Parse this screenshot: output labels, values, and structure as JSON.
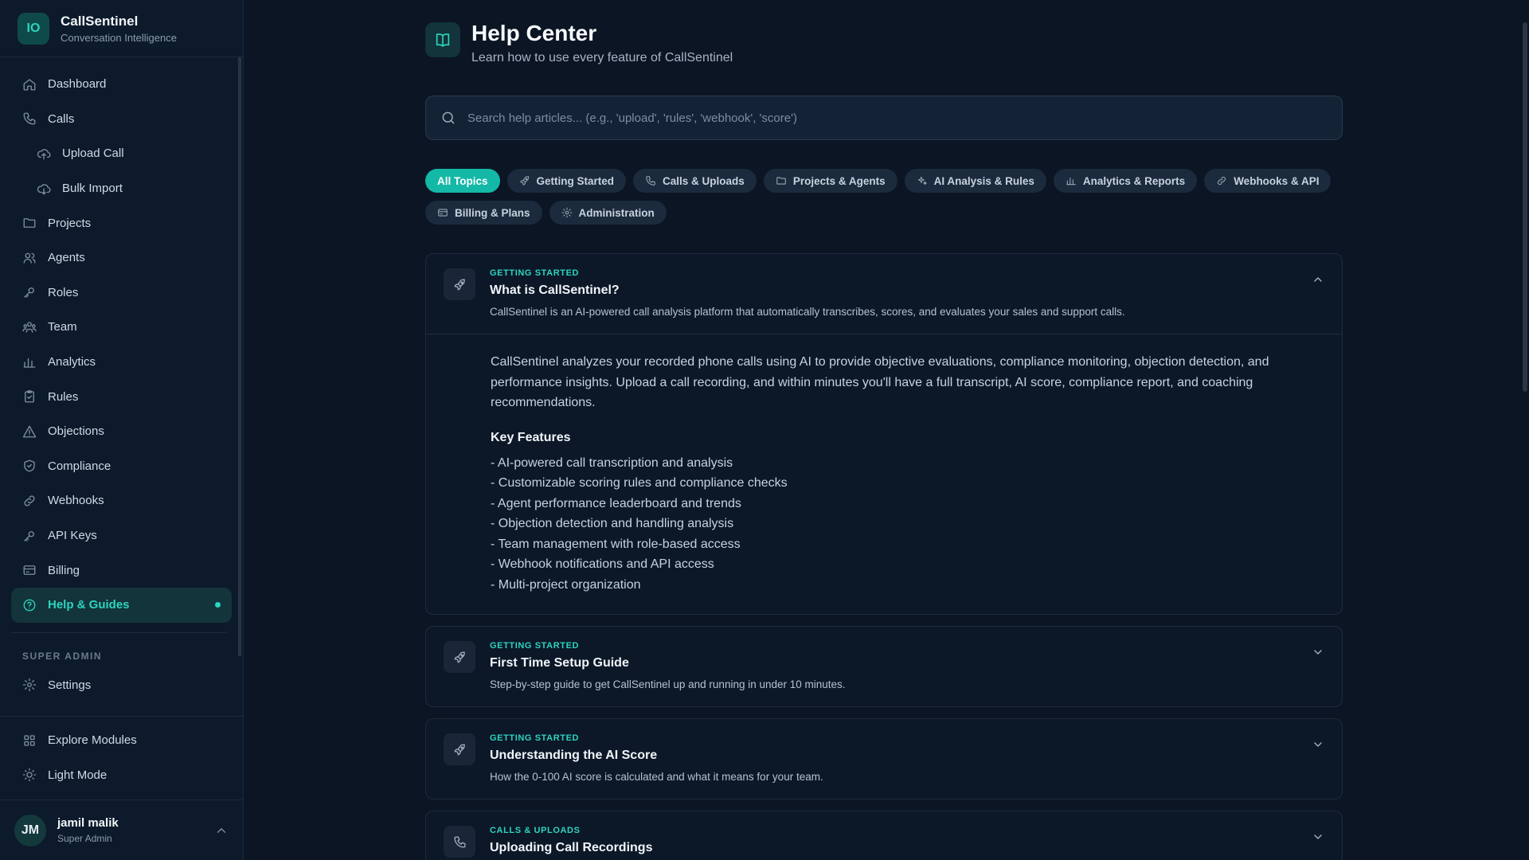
{
  "brand": {
    "logo": "IO",
    "name": "CallSentinel",
    "subtitle": "Conversation Intelligence"
  },
  "sidebar": {
    "items": [
      {
        "label": "Dashboard",
        "icon": "home-icon"
      },
      {
        "label": "Calls",
        "icon": "phone-icon"
      },
      {
        "label": "Upload Call",
        "icon": "cloud-upload-icon"
      },
      {
        "label": "Bulk Import",
        "icon": "cloud-download-icon"
      },
      {
        "label": "Projects",
        "icon": "folder-icon"
      },
      {
        "label": "Agents",
        "icon": "users-icon"
      },
      {
        "label": "Roles",
        "icon": "key-icon"
      },
      {
        "label": "Team",
        "icon": "team-icon"
      },
      {
        "label": "Analytics",
        "icon": "bar-chart-icon"
      },
      {
        "label": "Rules",
        "icon": "clipboard-icon"
      },
      {
        "label": "Objections",
        "icon": "warning-icon"
      },
      {
        "label": "Compliance",
        "icon": "shield-icon"
      },
      {
        "label": "Webhooks",
        "icon": "link-icon"
      },
      {
        "label": "API Keys",
        "icon": "key-icon"
      },
      {
        "label": "Billing",
        "icon": "credit-card-icon"
      },
      {
        "label": "Help & Guides",
        "icon": "help-circle-icon",
        "active": true
      }
    ],
    "section_label": "SUPER ADMIN",
    "settings_label": "Settings",
    "explore_label": "Explore Modules",
    "theme_label": "Light Mode"
  },
  "user": {
    "initials": "JM",
    "name": "jamil malik",
    "role": "Super Admin"
  },
  "header": {
    "title": "Help Center",
    "subtitle": "Learn how to use every feature of CallSentinel"
  },
  "search": {
    "placeholder": "Search help articles... (e.g., 'upload', 'rules', 'webhook', 'score')"
  },
  "chips": [
    {
      "label": "All Topics",
      "active": true
    },
    {
      "label": "Getting Started",
      "icon": "rocket-icon"
    },
    {
      "label": "Calls & Uploads",
      "icon": "phone-icon"
    },
    {
      "label": "Projects & Agents",
      "icon": "folder-icon"
    },
    {
      "label": "AI Analysis & Rules",
      "icon": "sparkles-icon"
    },
    {
      "label": "Analytics & Reports",
      "icon": "bar-chart-icon"
    },
    {
      "label": "Webhooks & API",
      "icon": "link-icon"
    },
    {
      "label": "Billing & Plans",
      "icon": "credit-card-icon"
    },
    {
      "label": "Administration",
      "icon": "gear-icon"
    }
  ],
  "articles": [
    {
      "category": "GETTING STARTED",
      "title": "What is CallSentinel?",
      "description": "CallSentinel is an AI-powered call analysis platform that automatically transcribes, scores, and evaluates your sales and support calls.",
      "expanded": true,
      "body": "CallSentinel analyzes your recorded phone calls using AI to provide objective evaluations, compliance monitoring, objection detection, and performance insights. Upload a call recording, and within minutes you'll have a full transcript, AI score, compliance report, and coaching recommendations.",
      "features_heading": "Key Features",
      "features": [
        "- AI-powered call transcription and analysis",
        "- Customizable scoring rules and compliance checks",
        "- Agent performance leaderboard and trends",
        "- Objection detection and handling analysis",
        "- Team management with role-based access",
        "- Webhook notifications and API access",
        "- Multi-project organization"
      ]
    },
    {
      "category": "GETTING STARTED",
      "title": "First Time Setup Guide",
      "description": "Step-by-step guide to get CallSentinel up and running in under 10 minutes."
    },
    {
      "category": "GETTING STARTED",
      "title": "Understanding the AI Score",
      "description": "How the 0-100 AI score is calculated and what it means for your team."
    },
    {
      "category": "CALLS & UPLOADS",
      "title": "Uploading Call Recordings",
      "description": ""
    }
  ]
}
